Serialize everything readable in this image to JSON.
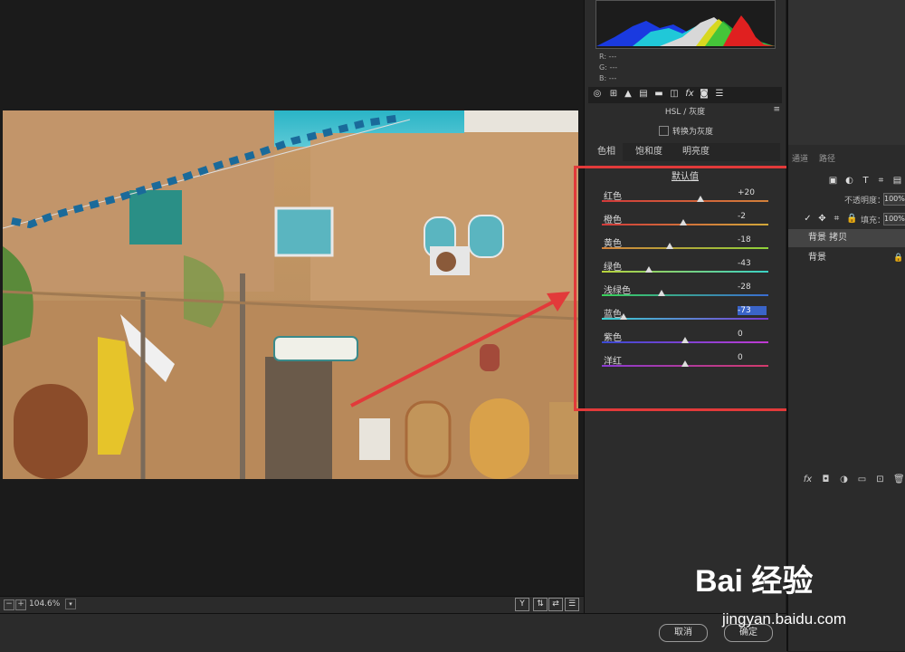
{
  "canvas": {
    "zoom": "104.6%",
    "zoom_out_label": "−",
    "zoom_in_label": "+",
    "zoom_dropdown_icon": "chevron-down-icon",
    "view_buttons": [
      "Y",
      "⇅",
      "⇄",
      "☰"
    ]
  },
  "footer": {
    "cancel_label": "取消",
    "ok_label": "确定"
  },
  "histogram": {
    "r": "R:  ---",
    "g": "G:  ---",
    "b": "B:  ---"
  },
  "acr_panel": {
    "tool_icons": [
      "aperture-icon",
      "grid-icon",
      "mountain-icon",
      "split-toning-icon",
      "detail-icon",
      "lens-icon",
      "fx-icon",
      "camera-icon",
      "presets-icon"
    ],
    "title": "HSL / 灰度",
    "menu_icon": "≡",
    "grayscale_label": "转换为灰度",
    "tabs": [
      "色相",
      "饱和度",
      "明亮度"
    ],
    "default_link": "默认值",
    "sliders": [
      {
        "label": "红色",
        "value": "+20",
        "fraction": 0.59,
        "colors": [
          "#d23a3a",
          "#d2813a"
        ]
      },
      {
        "label": "橙色",
        "value": "-2",
        "fraction": 0.49,
        "colors": [
          "#d23a3a",
          "#d2a83a"
        ]
      },
      {
        "label": "黄色",
        "value": "-18",
        "fraction": 0.41,
        "colors": [
          "#d2813a",
          "#8ed23a"
        ]
      },
      {
        "label": "绿色",
        "value": "-43",
        "fraction": 0.28,
        "colors": [
          "#b8d23a",
          "#3ad2c5"
        ]
      },
      {
        "label": "浅绿色",
        "value": "-28",
        "fraction": 0.36,
        "colors": [
          "#3ad25a",
          "#3a6cd2"
        ]
      },
      {
        "label": "蓝色",
        "value": "-73",
        "fraction": 0.13,
        "colors": [
          "#3ad2d2",
          "#7a3ad2"
        ]
      },
      {
        "label": "紫色",
        "value": "0",
        "fraction": 0.5,
        "colors": [
          "#3a4ad2",
          "#c23ad2"
        ]
      },
      {
        "label": "洋红",
        "value": "0",
        "fraction": 0.5,
        "colors": [
          "#8a3ad2",
          "#d23a6a"
        ]
      }
    ],
    "selected_slider": "蓝色"
  },
  "layers_panel": {
    "tabs": [
      "通道",
      "路径"
    ],
    "opacity_label": "不透明度：",
    "opacity_value": "100%",
    "fill_label": "填充：",
    "fill_value": "100%",
    "layers": [
      {
        "name": "背景 拷贝",
        "active": true
      },
      {
        "name": "背景",
        "active": false
      }
    ],
    "bottom_icons": [
      "fx-icon",
      "mask-icon",
      "adjustment-icon",
      "folder-icon",
      "new-layer-icon",
      "trash-icon"
    ]
  },
  "watermark": {
    "brand": "Bai 经验",
    "url": "jingyan.baidu.com"
  },
  "colors": {
    "highlight_box": "#e23a3a",
    "selection": "#3a64c8"
  }
}
